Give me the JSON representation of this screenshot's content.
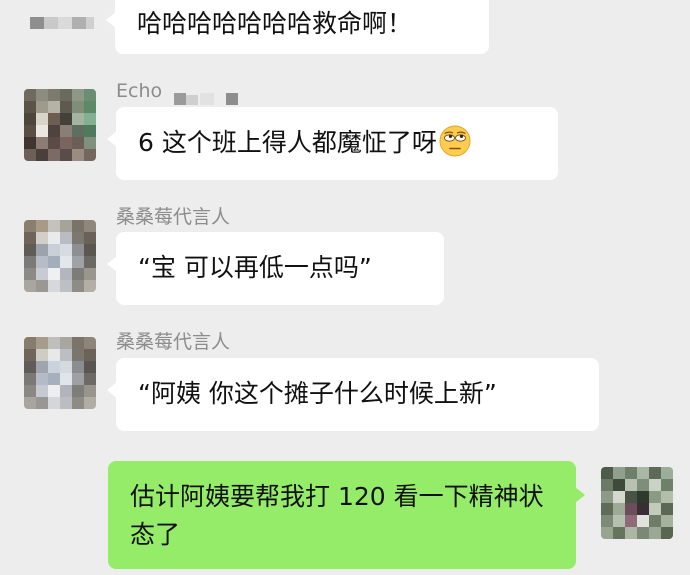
{
  "messages": [
    {
      "direction": "incoming",
      "sender": "",
      "text": "哈哈哈哈哈哈哈救命啊！",
      "sender_blurred": true
    },
    {
      "direction": "incoming",
      "sender": "Echo",
      "text": "6 这个班上得人都魔怔了呀",
      "emoji": "rolling-eyes-emoji"
    },
    {
      "direction": "incoming",
      "sender": "桑桑莓代言人",
      "text": "“宝 可以再低一点吗”"
    },
    {
      "direction": "incoming",
      "sender": "桑桑莓代言人",
      "text": "“阿姨 你这个摊子什么时候上新”"
    },
    {
      "direction": "outgoing",
      "sender": "",
      "text": "估计阿姨要帮我打 120 看一下精神状态了"
    }
  ],
  "colors": {
    "background": "#EDEDED",
    "incoming_bubble": "#FFFFFF",
    "outgoing_bubble": "#95EC69",
    "sender_name": "#8C8C8C",
    "message_text": "#111111"
  }
}
